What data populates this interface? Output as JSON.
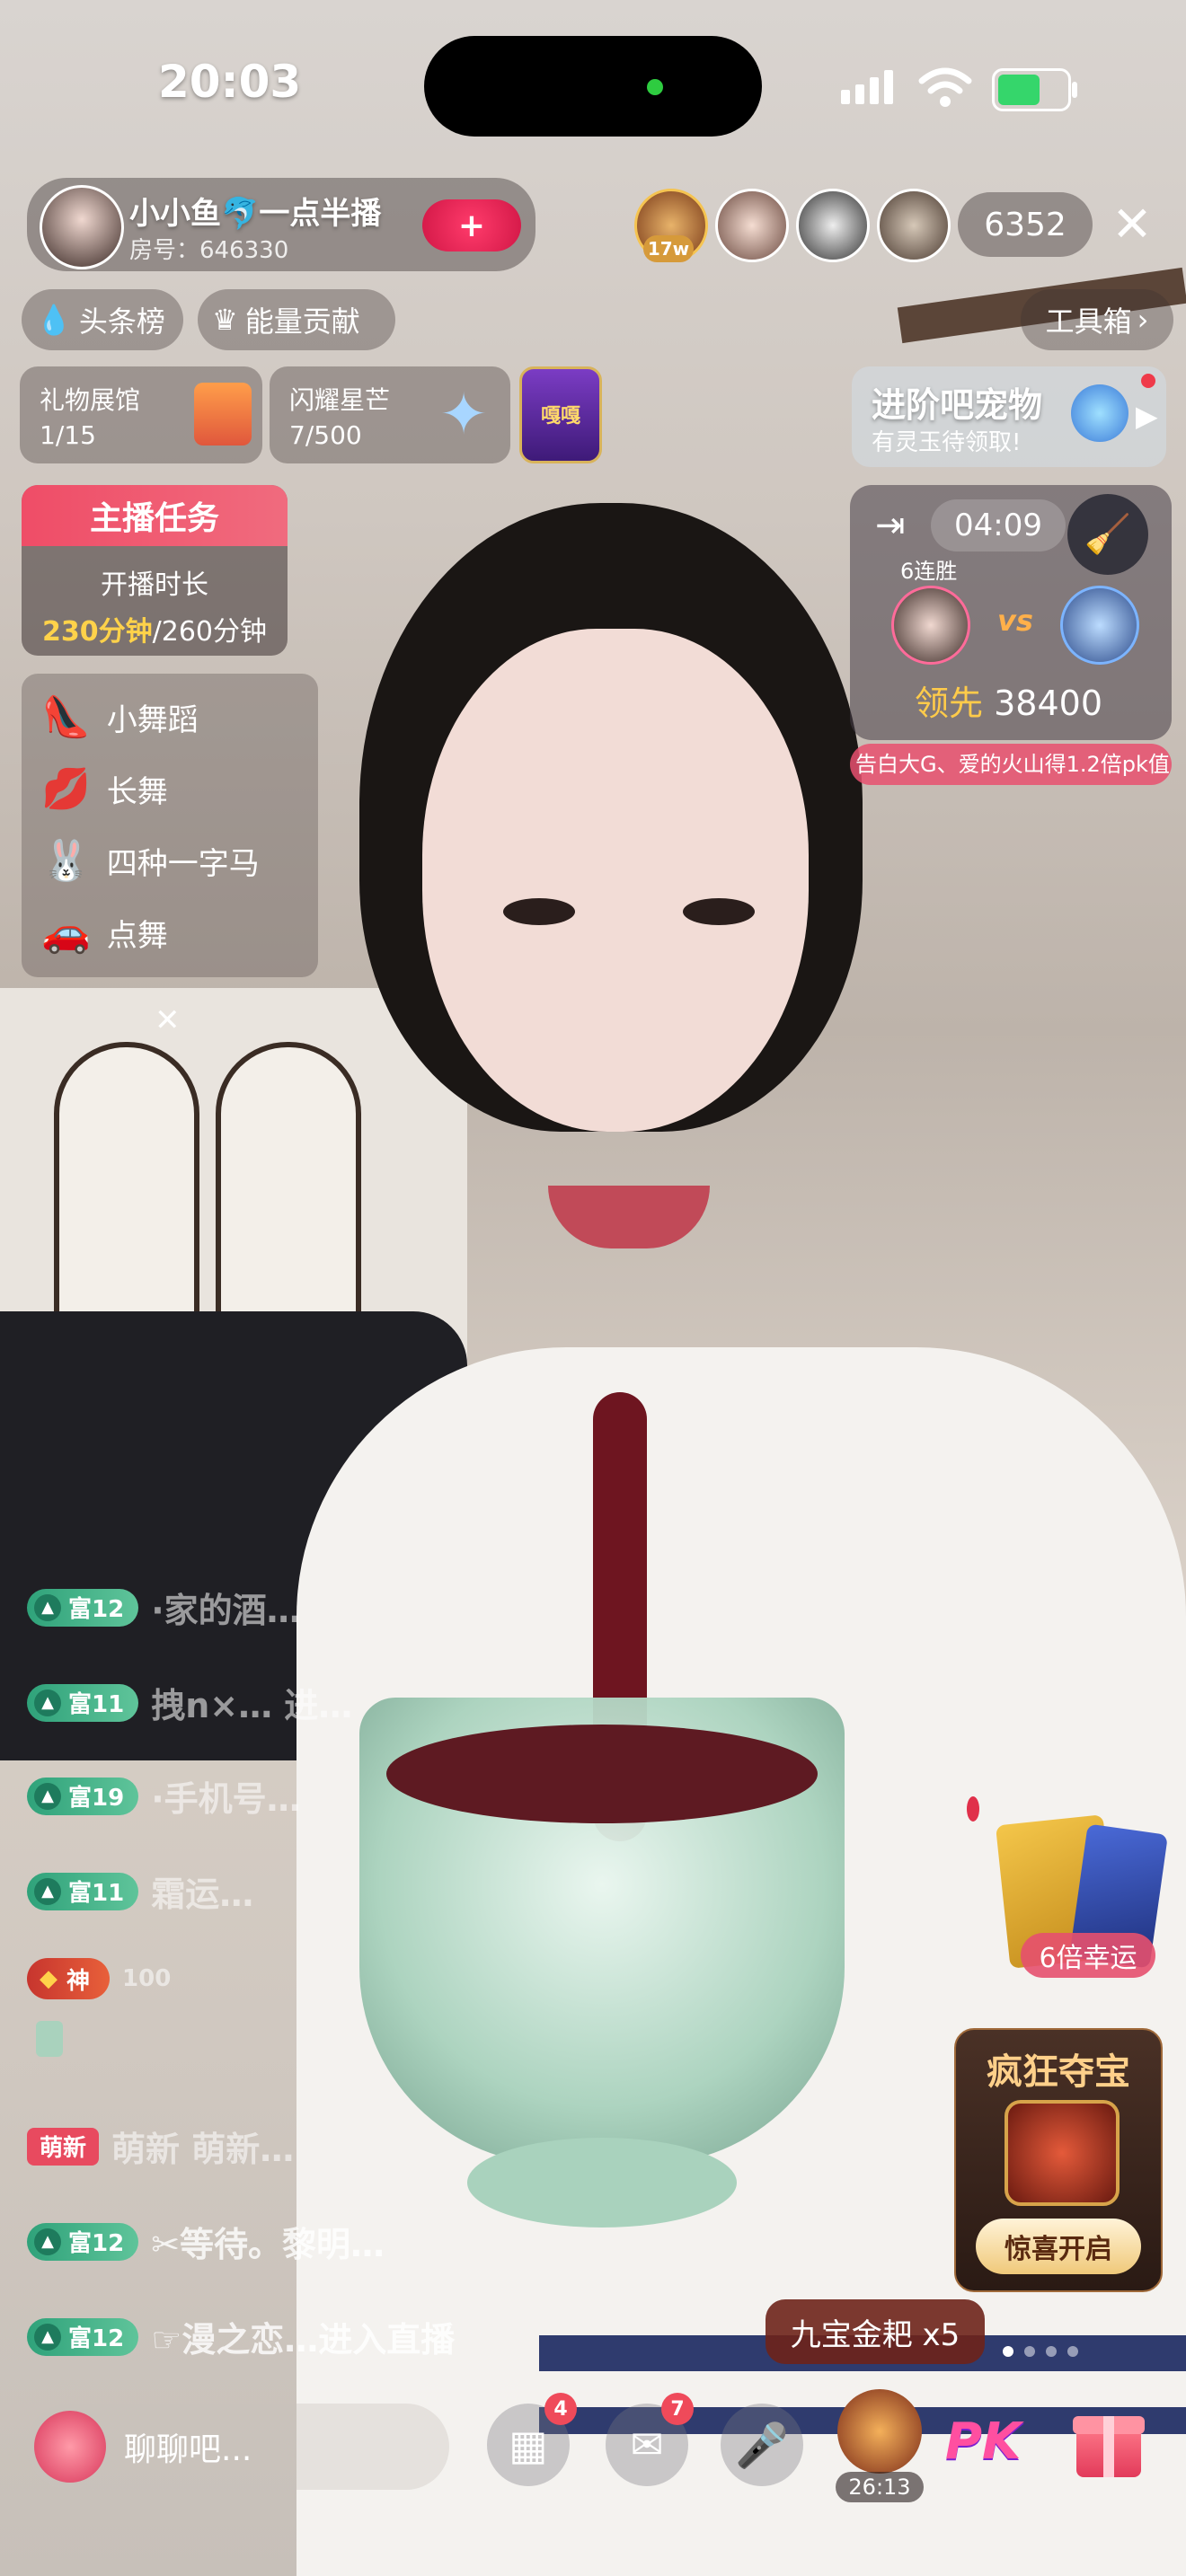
{
  "status_bar": {
    "time": "20:03"
  },
  "streamer": {
    "name": "小小鱼🐬一点半播",
    "room_label": "房号：646330",
    "follow_label": "+"
  },
  "viewers": {
    "top_badge": "17w",
    "count": "6352"
  },
  "top_tags": {
    "headline": "头条榜",
    "energy": "能量贡献",
    "toolbox": "工具箱"
  },
  "gift_cards": [
    {
      "title": "礼物展馆",
      "value": "1/15"
    },
    {
      "title": "闪耀星芒",
      "value": "7/500"
    }
  ],
  "medal_label": "嘎嘎",
  "pet_banner": {
    "title": "进阶吧宠物",
    "subtitle": "有灵玉待领取!"
  },
  "task": {
    "header": "主播任务",
    "line1": "开播时长",
    "progress": "230分钟",
    "total": "/260分钟"
  },
  "menu": [
    {
      "label": "小舞蹈",
      "icon": "high-heel-icon"
    },
    {
      "label": "长舞",
      "icon": "lips-icon"
    },
    {
      "label": "四种一字马",
      "icon": "bunny-icon"
    },
    {
      "label": "点舞",
      "icon": "car-icon"
    }
  ],
  "pk": {
    "timer": "04:09",
    "streak": "6连胜",
    "vs": "vs",
    "lead_label": "领先",
    "lead_value": "38400",
    "ticker": "告白大G、爱的火山得1.2倍pk值"
  },
  "chat": [
    {
      "level": "富12",
      "text": "·家的酒…"
    },
    {
      "level": "富11",
      "text": "拽n×… 进…"
    },
    {
      "level": "富19",
      "text": "·手机号…"
    },
    {
      "level": "富11",
      "text": "霜运…"
    },
    {
      "level": "神",
      "text": "100"
    },
    {
      "level": "萌新",
      "text": "萌新 萌新…"
    },
    {
      "level": "富12",
      "text": "✂等待。黎明…"
    },
    {
      "level": "富12",
      "text": "☞漫之恋…进入直播"
    }
  ],
  "lucky_label": "6倍幸运",
  "treasure": {
    "title": "疯狂夺宝",
    "button": "惊喜开启"
  },
  "gift_popup": "九宝金耙 x5",
  "bottom": {
    "input_placeholder": "聊聊吧...",
    "badge_apps": "4",
    "badge_msgs": "7",
    "timer": "26:13",
    "pk_label": "PK"
  }
}
